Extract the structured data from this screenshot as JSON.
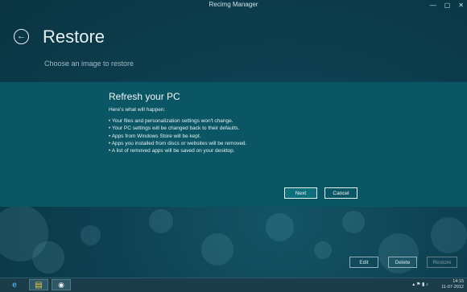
{
  "window": {
    "title": "Recimg Manager",
    "controls": [
      "—",
      "▢",
      "✕"
    ]
  },
  "page": {
    "back_icon": "←",
    "title": "Restore",
    "subtitle": "Choose an image to restore"
  },
  "dialog": {
    "title": "Refresh your PC",
    "intro": "Here's what will happen:",
    "bullets": [
      "• Your files and personalization settings won't change.",
      "• Your PC settings will be changed back to their defaults.",
      "• Apps from Windows Store will be kept.",
      "• Apps you installed from discs or websites will be removed.",
      "• A list of removed apps will be saved on your desktop."
    ],
    "next_label": "Next",
    "cancel_label": "Cancel"
  },
  "actions": {
    "edit_label": "Edit",
    "delete_label": "Delete",
    "restore_label": "Restore"
  },
  "taskbar": {
    "icons": [
      "ie-icon",
      "folder-icon",
      "recimg-app-icon"
    ],
    "ie_glyph": "e",
    "folder_glyph": "▤",
    "app_glyph": "◉",
    "time": "14:15",
    "date": "11-07-2012",
    "tray_glyphs": "▴ ⚑ ▮ ♪"
  },
  "colors": {
    "background": "#0d4051",
    "dialog": "#0b5664",
    "accent_button": "#0e6f7c",
    "taskbar": "#1b3d4a"
  }
}
